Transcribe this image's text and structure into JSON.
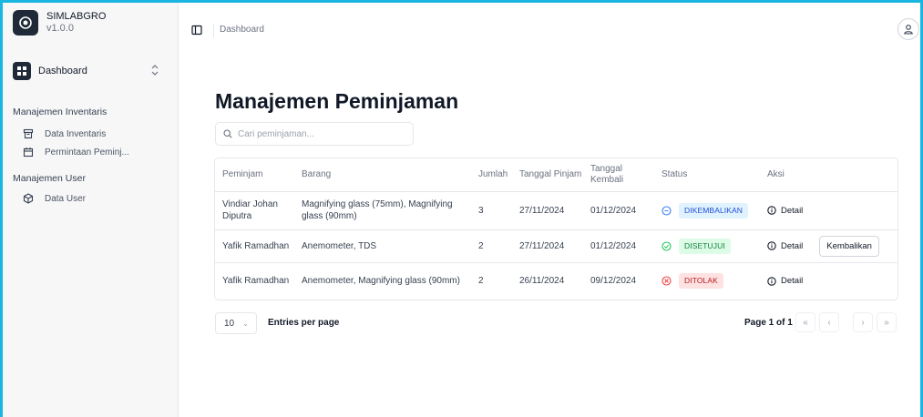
{
  "app": {
    "name": "SIMLABGRO",
    "version": "v1.0.0"
  },
  "sidebar": {
    "team_label": "Dashboard",
    "groups": [
      {
        "label": "Manajemen Inventaris",
        "items": [
          {
            "label": "Data Inventaris",
            "icon": "archive-icon"
          },
          {
            "label": "Permintaan Peminj...",
            "icon": "calendar-icon"
          }
        ]
      },
      {
        "label": "Manajemen User",
        "items": [
          {
            "label": "Data User",
            "icon": "box-icon"
          }
        ]
      }
    ]
  },
  "header": {
    "breadcrumb": "Dashboard"
  },
  "main": {
    "title": "Manajemen Peminjaman",
    "search_placeholder": "Cari peminjaman...",
    "columns": {
      "peminjam": "Peminjam",
      "barang": "Barang",
      "jumlah": "Jumlah",
      "tanggal_pinjam": "Tanggal Pinjam",
      "tanggal_kembali": "Tanggal Kembali",
      "status": "Status",
      "aksi": "Aksi"
    },
    "rows": [
      {
        "peminjam": "Vindiar Johan Diputra",
        "barang": "Magnifying glass (75mm), Magnifying glass (90mm)",
        "jumlah": "3",
        "tanggal_pinjam": "27/11/2024",
        "tanggal_kembali": "01/12/2024",
        "status": "DIKEMBALIKAN",
        "detail": "Detail"
      },
      {
        "peminjam": "Yafik Ramadhan",
        "barang": "Anemometer, TDS",
        "jumlah": "2",
        "tanggal_pinjam": "27/11/2024",
        "tanggal_kembali": "01/12/2024",
        "status": "DISETUJUI",
        "detail": "Detail",
        "return_label": "Kembalikan"
      },
      {
        "peminjam": "Yafik Ramadhan",
        "barang": "Anemometer, Magnifying glass (90mm)",
        "jumlah": "2",
        "tanggal_pinjam": "26/11/2024",
        "tanggal_kembali": "09/12/2024",
        "status": "DITOLAK",
        "detail": "Detail"
      }
    ],
    "status_colors": {
      "DIKEMBALIKAN": {
        "text": "#1d4ed8",
        "bg": "#e0f2fe",
        "icon": "#3b82f6"
      },
      "DISETUJUI": {
        "text": "#15803d",
        "bg": "#dcfce7",
        "icon": "#22c55e"
      },
      "DITOLAK": {
        "text": "#b91c1c",
        "bg": "#fee2e2",
        "icon": "#ef4444"
      }
    }
  },
  "pagination": {
    "per_page_value": "10",
    "per_page_label": "Entries per page",
    "page_info": "Page 1 of 1",
    "first": "«",
    "prev": "‹",
    "next": "›",
    "last": "»"
  },
  "accent_color": "#19b6e0"
}
